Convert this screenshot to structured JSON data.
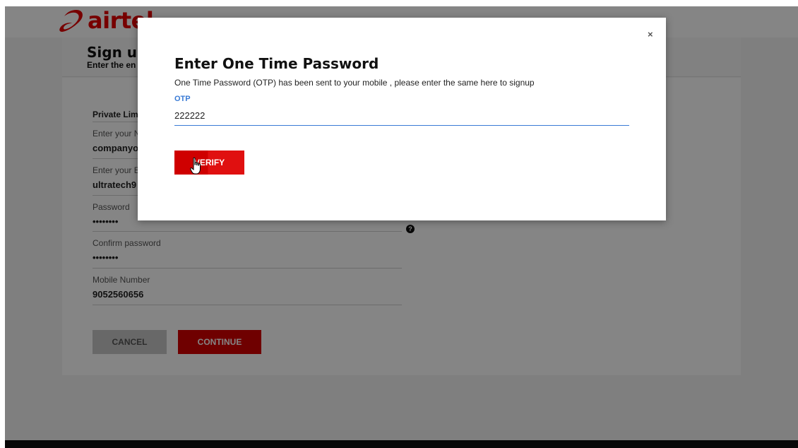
{
  "header": {
    "logo_text": "airtel",
    "brand_color": "#e40000"
  },
  "page": {
    "title": "Sign up",
    "subtitle": "Enter the en"
  },
  "form": {
    "company_type": "Private Lim",
    "name_label": "Enter your N",
    "name_value": "companyo",
    "email_label": "Enter your E",
    "email_value": "ultratech9",
    "password_label": "Password",
    "password_value": "••••••••",
    "confirm_label": "Confirm password",
    "confirm_value": "••••••••",
    "mobile_label": "Mobile Number",
    "mobile_value": "9052560656",
    "help_icon": "?",
    "cancel_label": "CANCEL",
    "continue_label": "CONTINUE"
  },
  "modal": {
    "close_label": "×",
    "title": "Enter One Time Password",
    "description": "One Time Password (OTP) has been sent to your mobile , please enter the same here to signup",
    "otp_label": "OTP",
    "otp_value": "222222",
    "verify_label": "VERIFY",
    "accent_color": "#3a7bd5"
  }
}
